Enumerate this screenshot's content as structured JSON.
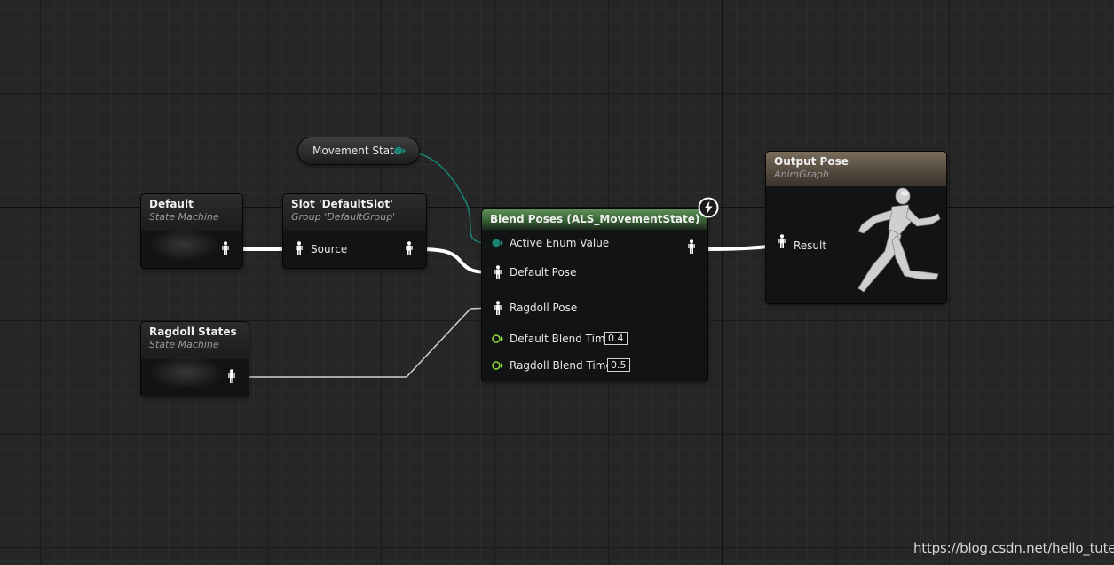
{
  "graph": {
    "background": "#262626",
    "wires": {
      "exec_color": "#ffffff",
      "enum_color": "#1b8a7a",
      "thin_color": "#c8c8c8"
    }
  },
  "nodes": {
    "default_sm": {
      "title": "Default",
      "subtitle": "State Machine"
    },
    "ragdoll_sm": {
      "title": "Ragdoll States",
      "subtitle": "State Machine"
    },
    "slot": {
      "title": "Slot 'DefaultSlot'",
      "subtitle": "Group 'DefaultGroup'",
      "input_label": "Source"
    },
    "movement_state": {
      "label": "Movement State"
    },
    "blend": {
      "title": "Blend Poses (ALS_MovementState)",
      "header_color": "#4f7d49",
      "pins": {
        "active_enum": "Active Enum Value",
        "default_pose": "Default Pose",
        "ragdoll_pose": "Ragdoll Pose",
        "default_blend_time": "Default Blend Time",
        "ragdoll_blend_time": "Ragdoll Blend Time"
      },
      "values": {
        "default_blend_time": "0.4",
        "ragdoll_blend_time": "0.5"
      },
      "float_pin_color": "#8fd43a",
      "badge_icon": "lightning-icon"
    },
    "output": {
      "title": "Output Pose",
      "subtitle": "AnimGraph",
      "input_label": "Result",
      "preview_icon": "running-mannequin-icon"
    }
  },
  "watermark": "https://blog.csdn.net/hello_tute"
}
